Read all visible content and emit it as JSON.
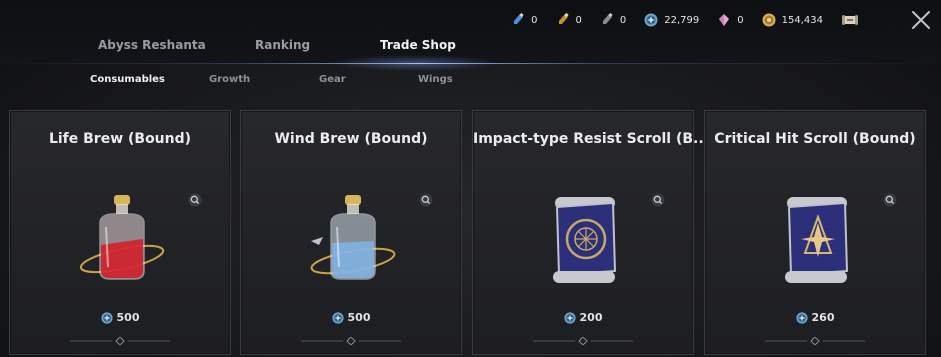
{
  "colors": {
    "accent": "#9ec2ff",
    "card_bg": "#24252a",
    "text": "#ececec",
    "muted": "#8f9196"
  },
  "currencies": [
    {
      "icon": "blue-vial-icon",
      "value": "0"
    },
    {
      "icon": "gold-vial-icon",
      "value": "0"
    },
    {
      "icon": "gray-vial-icon",
      "value": "0"
    },
    {
      "icon": "blue-coin-icon",
      "value": "22,799"
    },
    {
      "icon": "pink-crystal-icon",
      "value": "0"
    },
    {
      "icon": "gold-coin-icon",
      "value": "154,434"
    },
    {
      "icon": "scroll-bundle-icon",
      "value": ""
    }
  ],
  "tabs": [
    {
      "label": "Abyss Reshanta",
      "active": false
    },
    {
      "label": "Ranking",
      "active": false
    },
    {
      "label": "Trade Shop",
      "active": true
    }
  ],
  "subtabs": [
    {
      "label": "Consumables",
      "active": true
    },
    {
      "label": "Growth",
      "active": false
    },
    {
      "label": "Gear",
      "active": false
    },
    {
      "label": "Wings",
      "active": false
    }
  ],
  "items": [
    {
      "name": "Life Brew (Bound)",
      "price": "500",
      "icon": "red-potion-icon"
    },
    {
      "name": "Wind Brew (Bound)",
      "price": "500",
      "icon": "blue-potion-icon"
    },
    {
      "name": "Impact-type Resist Scroll (B...",
      "price": "200",
      "icon": "resist-scroll-icon"
    },
    {
      "name": "Critical Hit Scroll (Bound)",
      "price": "260",
      "icon": "critical-scroll-icon"
    }
  ]
}
